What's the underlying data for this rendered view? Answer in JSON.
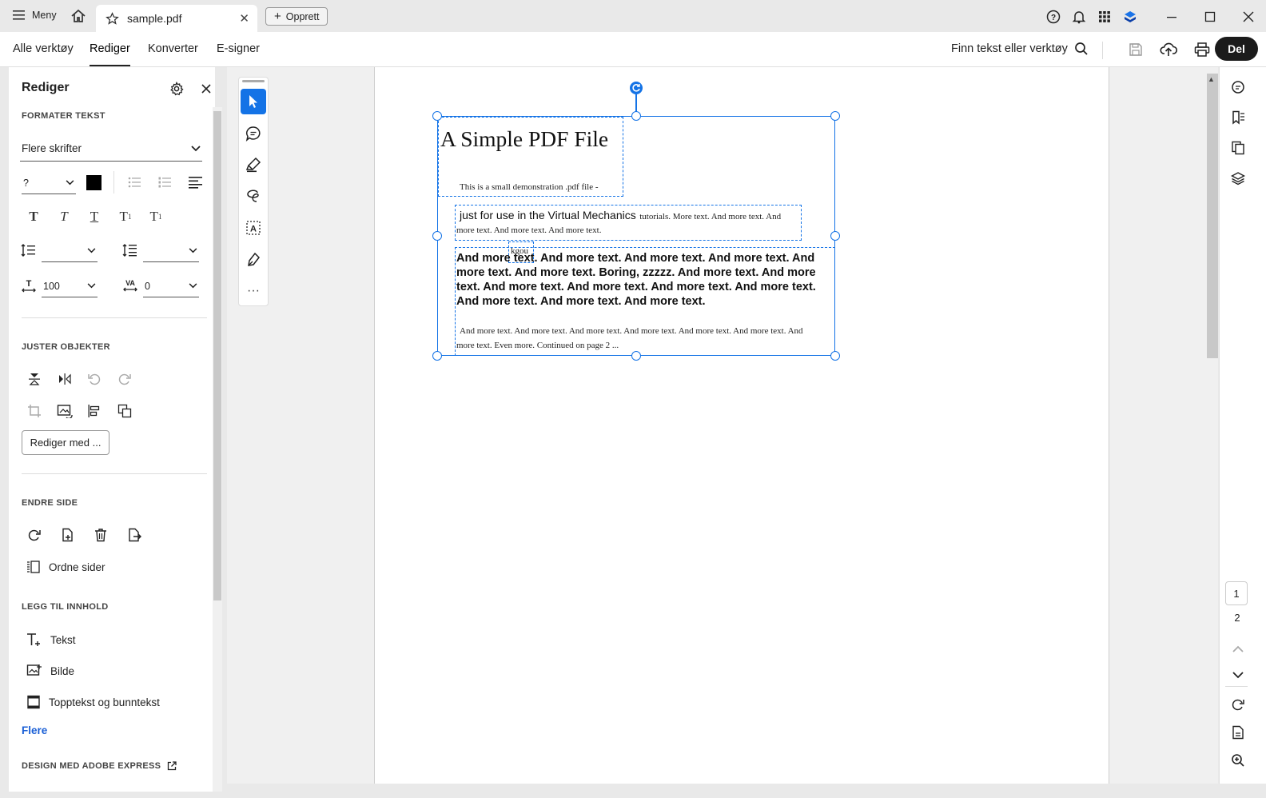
{
  "titlebar": {
    "menu_label": "Meny",
    "tab_title": "sample.pdf",
    "create_label": "Opprett"
  },
  "menubar": {
    "items": [
      "Alle verktøy",
      "Rediger",
      "Konverter",
      "E-signer"
    ],
    "active": "Rediger",
    "find_label": "Finn tekst eller verktøy",
    "share_label": "Del"
  },
  "panel": {
    "title": "Rediger",
    "section_format": "FORMATER TEKST",
    "font_value": "Flere skrifter",
    "size_value": "?",
    "scale_value": "100",
    "tracking_value": "0",
    "section_arrange": "JUSTER OBJEKTER",
    "edit_with_label": "Rediger med ...",
    "section_page": "ENDRE SIDE",
    "arrange_pages_label": "Ordne sider",
    "section_add": "LEGG TIL INNHOLD",
    "add_text_label": "Tekst",
    "add_image_label": "Bilde",
    "header_footer_label": "Topptekst og bunntekst",
    "more_label": "Flere",
    "section_express": "DESIGN MED ADOBE EXPRESS"
  },
  "pdf": {
    "title": "A Simple PDF File",
    "line1": "This is a small demonstration .pdf file -",
    "line2_large": "just for use in the Virtual Mechanics",
    "line2_small": "tutorials. More text. And more  text. And",
    "line3": "more text. And more text. And more text.",
    "overlay_text": "kgou",
    "bold_para": "And more text. And more text. And more text. And more text. And more  text. And more text. Boring, zzzzz. And more text. And more text. And  more text. And more text. And more text. And more text. And more text.  And more text. And more text.",
    "para1": "And more text. And more text. And more text. And more text. And more  text. And more text. And",
    "para2": "more text. Even more. Continued on page 2 ..."
  },
  "pagination": {
    "current": "1",
    "next": "2"
  }
}
